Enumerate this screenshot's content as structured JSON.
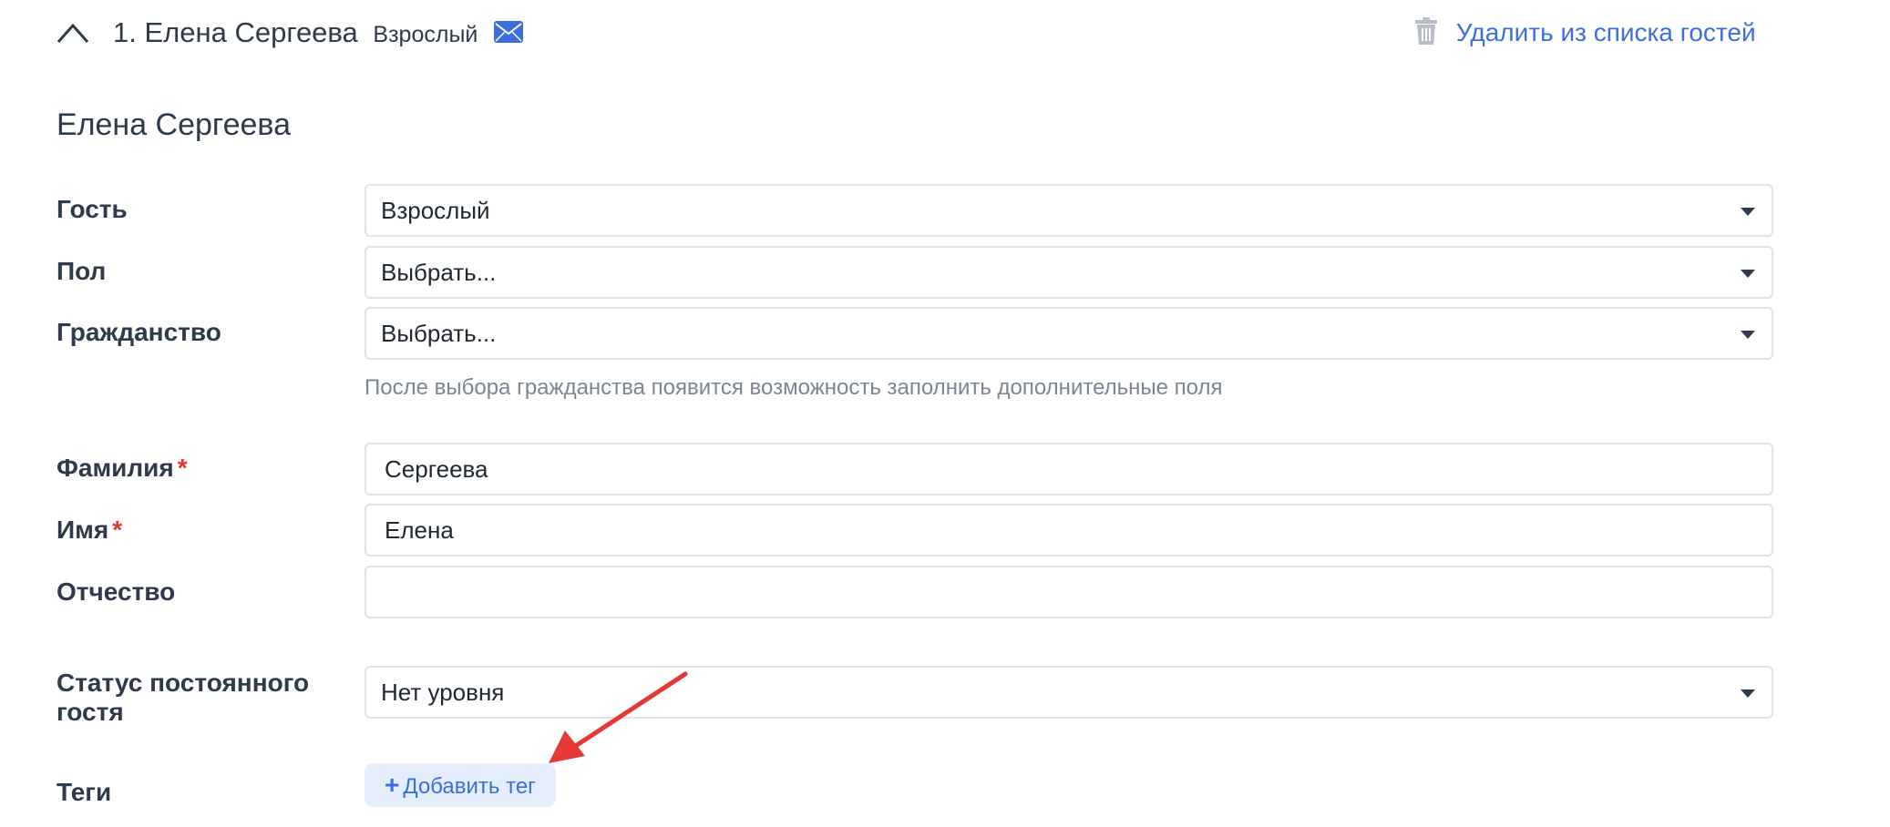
{
  "header": {
    "guest_title": "1. Елена Сергеева",
    "guest_type": "Взрослый",
    "delete_label": "Удалить из списка гостей"
  },
  "icons": {
    "collapse": "chevron-up-icon",
    "mail": "envelope-icon",
    "delete": "trash-icon",
    "add": "plus-icon"
  },
  "colors": {
    "accent": "#3b6fe0",
    "required": "#e0352b",
    "annotation_arrow": "#e53935",
    "tag_button_bg": "#e4edfb"
  },
  "form": {
    "section_title": "Елена Сергеева",
    "guest": {
      "label": "Гость",
      "value": "Взрослый"
    },
    "gender": {
      "label": "Пол",
      "value": "Выбрать..."
    },
    "citizenship": {
      "label": "Гражданство",
      "value": "Выбрать...",
      "hint": "После выбора гражданства появится возможность заполнить дополнительные поля"
    },
    "last_name": {
      "label": "Фамилия",
      "required_mark": "*",
      "value": "Сергеева"
    },
    "first_name": {
      "label": "Имя",
      "required_mark": "*",
      "value": "Елена"
    },
    "middle_name": {
      "label": "Отчество",
      "value": ""
    },
    "loyalty": {
      "label_line1": "Статус постоянного",
      "label_line2": "гостя",
      "value": "Нет уровня"
    },
    "tags": {
      "label": "Теги",
      "add_plus": "+",
      "add_label": "Добавить тег"
    }
  }
}
